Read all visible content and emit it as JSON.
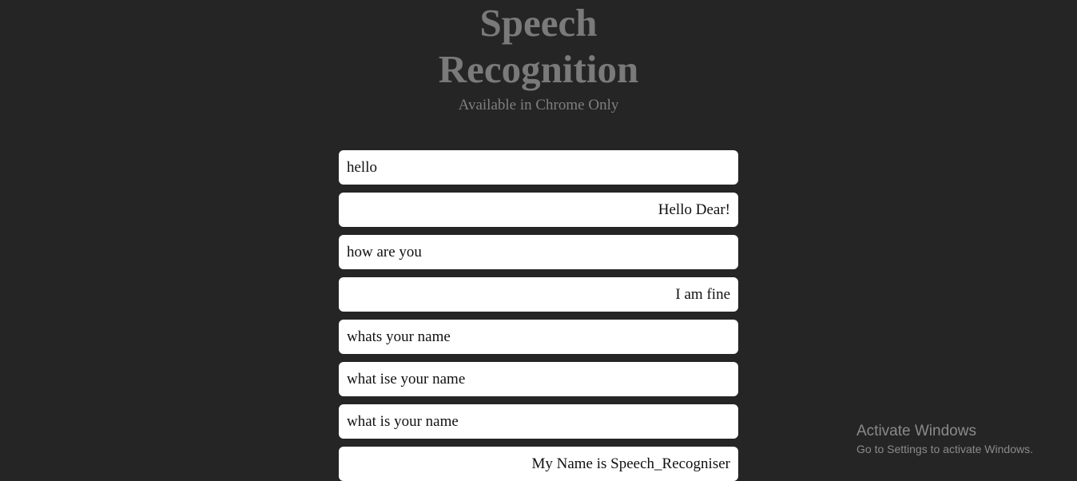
{
  "header": {
    "title_line1": "Speech",
    "title_line2": "Recognition",
    "subtitle": "Available in Chrome Only"
  },
  "messages": [
    {
      "speaker": "user",
      "text": "hello"
    },
    {
      "speaker": "bot",
      "text": "Hello Dear!"
    },
    {
      "speaker": "user",
      "text": "how are you"
    },
    {
      "speaker": "bot",
      "text": "I am fine"
    },
    {
      "speaker": "user",
      "text": "whats your name"
    },
    {
      "speaker": "user",
      "text": "what ise your name"
    },
    {
      "speaker": "user",
      "text": "what is your name"
    },
    {
      "speaker": "bot",
      "text": "My Name is Speech_Recogniser"
    }
  ],
  "watermark": {
    "title": "Activate Windows",
    "subtitle": "Go to Settings to activate Windows."
  },
  "colors": {
    "background": "#252525",
    "heading": "#7a7a7a",
    "bubble": "#ffffff",
    "bubble_text": "#111111"
  }
}
